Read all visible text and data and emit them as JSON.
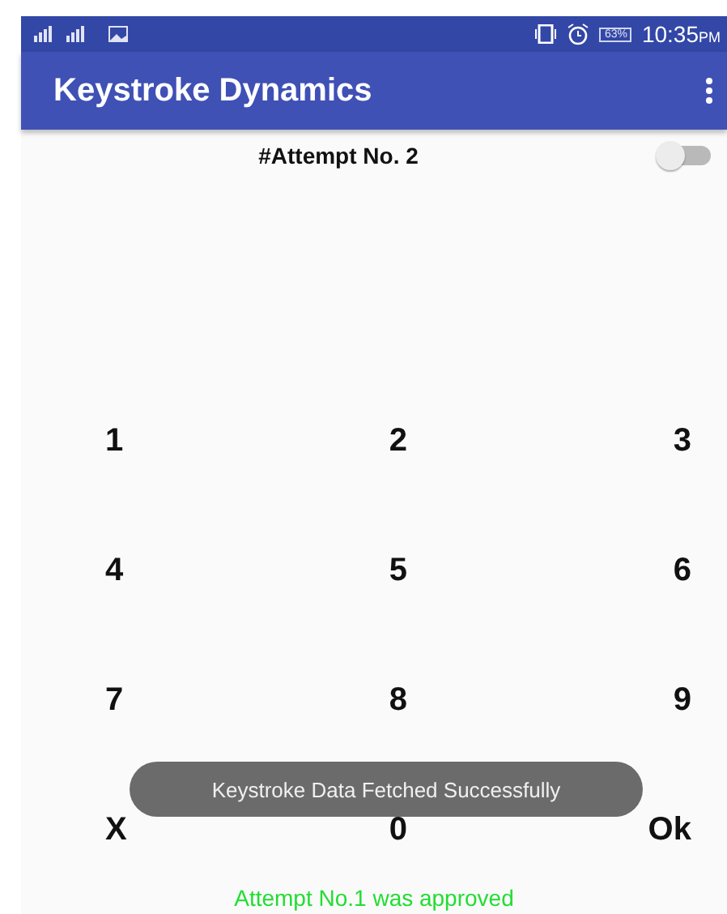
{
  "status_bar": {
    "battery": "63%",
    "time": "10:35",
    "time_suffix": "PM"
  },
  "app_bar": {
    "title": "Keystroke Dynamics"
  },
  "attempt": {
    "label": "#Attempt No. 2",
    "toggle_on": false
  },
  "keypad": [
    [
      "1",
      "2",
      "3"
    ],
    [
      "4",
      "5",
      "6"
    ],
    [
      "7",
      "8",
      "9"
    ],
    [
      "X",
      "0",
      "Ok"
    ]
  ],
  "toast": "Keystroke Data Fetched Successfully",
  "result": "Attempt No.1 was approved"
}
